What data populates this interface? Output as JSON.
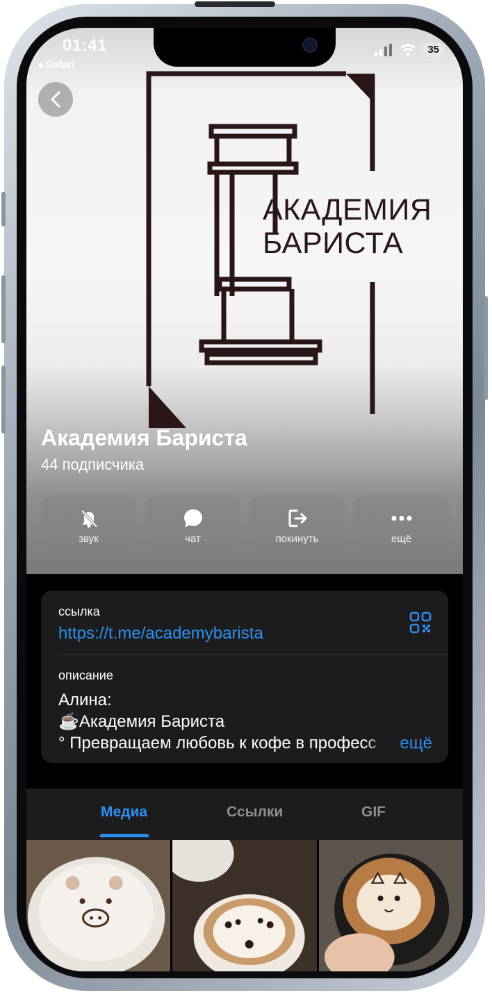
{
  "status_bar": {
    "time": "01:41",
    "back_app": "Safari",
    "battery": "35"
  },
  "channel": {
    "logo_line1": "АКАДЕМИЯ",
    "logo_line2": "БАРИСТА",
    "name": "Академия Бариста",
    "subscribers": "44 подписчика"
  },
  "actions": [
    {
      "label": "звук",
      "icon": "bell-slash-icon"
    },
    {
      "label": "чат",
      "icon": "chat-bubble-icon"
    },
    {
      "label": "покинуть",
      "icon": "leave-icon"
    },
    {
      "label": "ещё",
      "icon": "more-icon"
    }
  ],
  "info": {
    "link_label": "ссылка",
    "link": "https://t.me/academybarista",
    "description_label": "описание",
    "description_lines": [
      "Алина:",
      "☕Академия Бариста",
      "° Превращаем любовь к кофе в професс"
    ],
    "more": "ещё"
  },
  "tabs": [
    {
      "label": "Медиа",
      "active": true
    },
    {
      "label": "Ссылки",
      "active": false
    },
    {
      "label": "GIF",
      "active": false
    }
  ],
  "media": [
    "latte-art-pig",
    "latte-art-bears",
    "latte-art-cat"
  ],
  "colors": {
    "accent": "#2e8ff0",
    "card": "#1c1c1e",
    "logo": "#2a1616"
  }
}
